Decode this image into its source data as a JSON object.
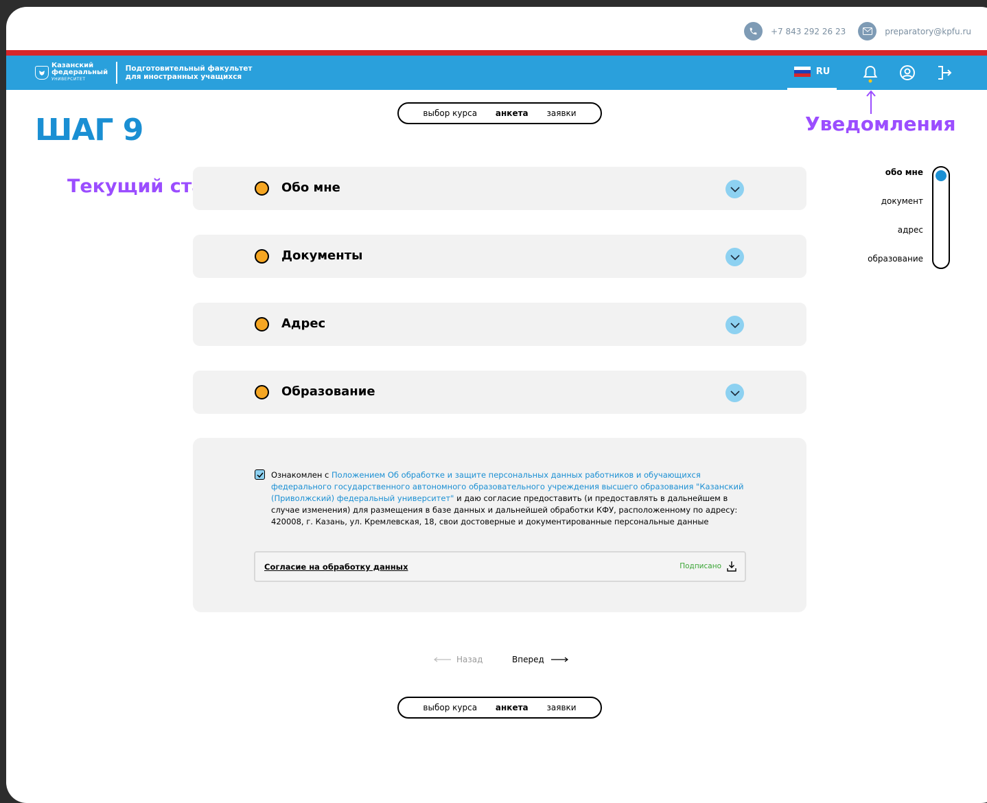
{
  "contacts": {
    "phone": "+7 843 292 26 23",
    "email": "preparatory@kpfu.ru"
  },
  "header": {
    "logo_line1": "Казанский",
    "logo_line2": "федеральный",
    "logo_line3": "УНИВЕРСИТЕТ",
    "faculty_line1": "Подготовительный факультет",
    "faculty_line2": "для иностранных учащихся",
    "lang": "RU"
  },
  "annotations": {
    "notifications": "Уведомления",
    "current_status": "Текущий статус"
  },
  "step_title": "ШАГ 9",
  "tabs": {
    "course": "выбор курса",
    "form": "анкета",
    "requests": "заявки"
  },
  "sections": [
    {
      "label": "Обо мне"
    },
    {
      "label": "Документы"
    },
    {
      "label": "Адрес"
    },
    {
      "label": "Образование"
    }
  ],
  "side_nav": [
    "обо мне",
    "документ",
    "адрес",
    "образование"
  ],
  "consent": {
    "prefix": "Ознакомлен с ",
    "link": "Положением Об обработке и защите персональных данных работников и обучающихся федерального государственного автономного образовательного учреждения высшего образования \"Казанский (Приволжский) федеральный университет\"",
    "suffix": " и даю согласие предоставить (и предоставлять в дальнейшем в случае изменения) для размещения в базе данных и дальнейшей обработки КФУ, расположенному по адресу: 420008, г. Казань, ул. Кремлевская, 18, свои достоверные и документированные персональные данные",
    "checked": true,
    "doc_label": "Согласие на обработку данных",
    "doc_status": "Подписано"
  },
  "nav": {
    "back": "Назад",
    "next": "Вперед"
  },
  "colors": {
    "accent": "#1a8fd3",
    "annotation": "#9b4dff",
    "status_dot": "#f5a623",
    "signed": "#3aa535"
  }
}
